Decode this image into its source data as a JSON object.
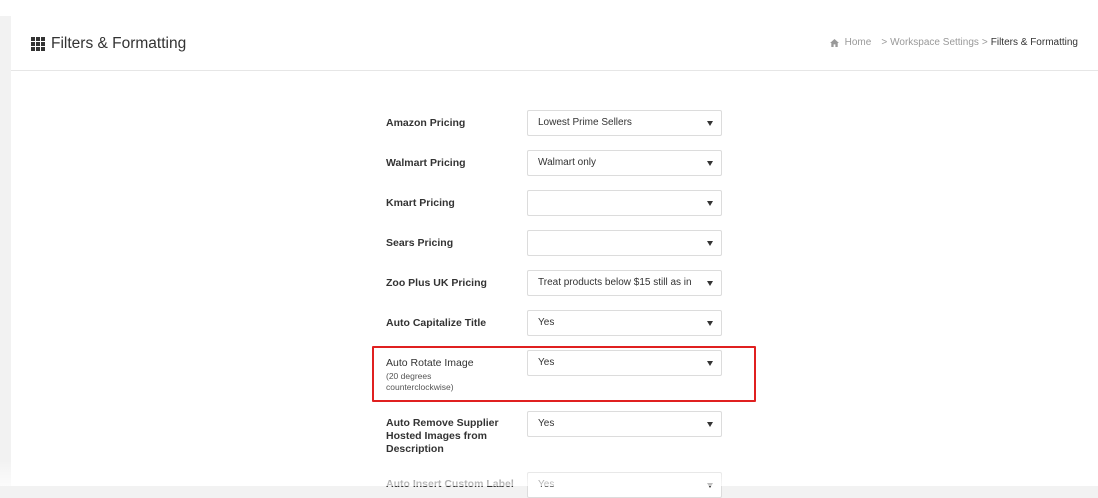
{
  "header": {
    "title": "Filters & Formatting",
    "title_icon": "grid-icon"
  },
  "breadcrumb": {
    "home": "Home",
    "parent": "Workspace Settings",
    "current": "Filters & Formatting",
    "separator": ">"
  },
  "settings": [
    {
      "label": "Amazon Pricing",
      "value": "Lowest Prime Sellers"
    },
    {
      "label": "Walmart Pricing",
      "value": "Walmart only"
    },
    {
      "label": "Kmart Pricing",
      "value": ""
    },
    {
      "label": "Sears Pricing",
      "value": ""
    },
    {
      "label": "Zoo Plus UK Pricing",
      "value": "Treat products below $15 still as in"
    },
    {
      "label": "Auto Capitalize Title",
      "value": "Yes"
    },
    {
      "label": "Auto Rotate Image",
      "sublabel": "(20 degrees counterclockwise)",
      "value": "Yes"
    },
    {
      "label": "Auto Remove Supplier Hosted Images from Description",
      "value": "Yes"
    },
    {
      "label": "Auto Insert Custom Label",
      "value": "Yes"
    }
  ],
  "colors": {
    "highlight_border": "#e02020",
    "page_bg": "#f2f2f2",
    "panel_bg": "#ffffff"
  }
}
